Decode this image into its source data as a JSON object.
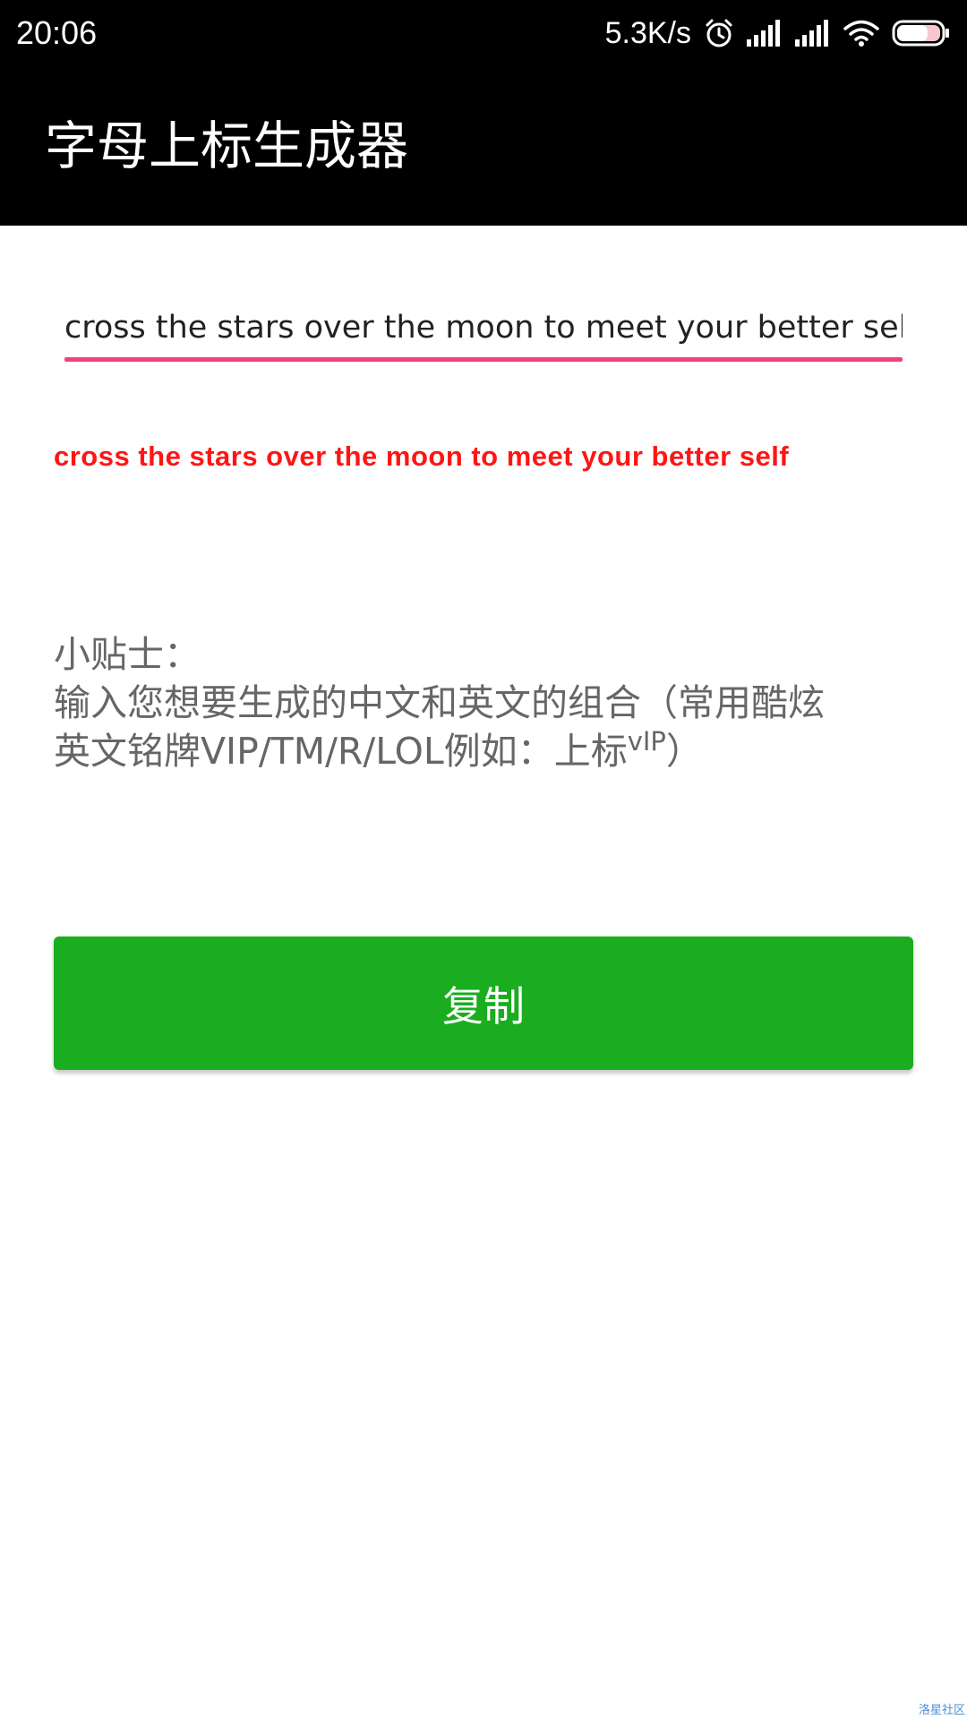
{
  "status_bar": {
    "time": "20:06",
    "speed": "5.3K/s",
    "battery_level": "69",
    "icons": [
      "alarm-icon",
      "signal-icon",
      "signal-icon",
      "wifi-icon",
      "battery-icon"
    ]
  },
  "app_bar": {
    "title": "字母上标生成器"
  },
  "input": {
    "value": "cross the stars over the moon to meet your better self",
    "underline_color": "#f0437b"
  },
  "output": {
    "text": "cross the stars over the moon to meet your better self",
    "color": "#ff1515"
  },
  "tips": {
    "heading": "小贴士：",
    "line1": "输入您想要生成的中文和英文的组合（常用酷炫",
    "line2_prefix": "英文铭牌VIP/TM/R/LOL例如：上标",
    "line2_sup": "vIP",
    "line2_suffix": "）"
  },
  "copy_button": {
    "label": "复制",
    "color": "#1aad1f"
  },
  "watermark": {
    "text": "洛星社区"
  }
}
